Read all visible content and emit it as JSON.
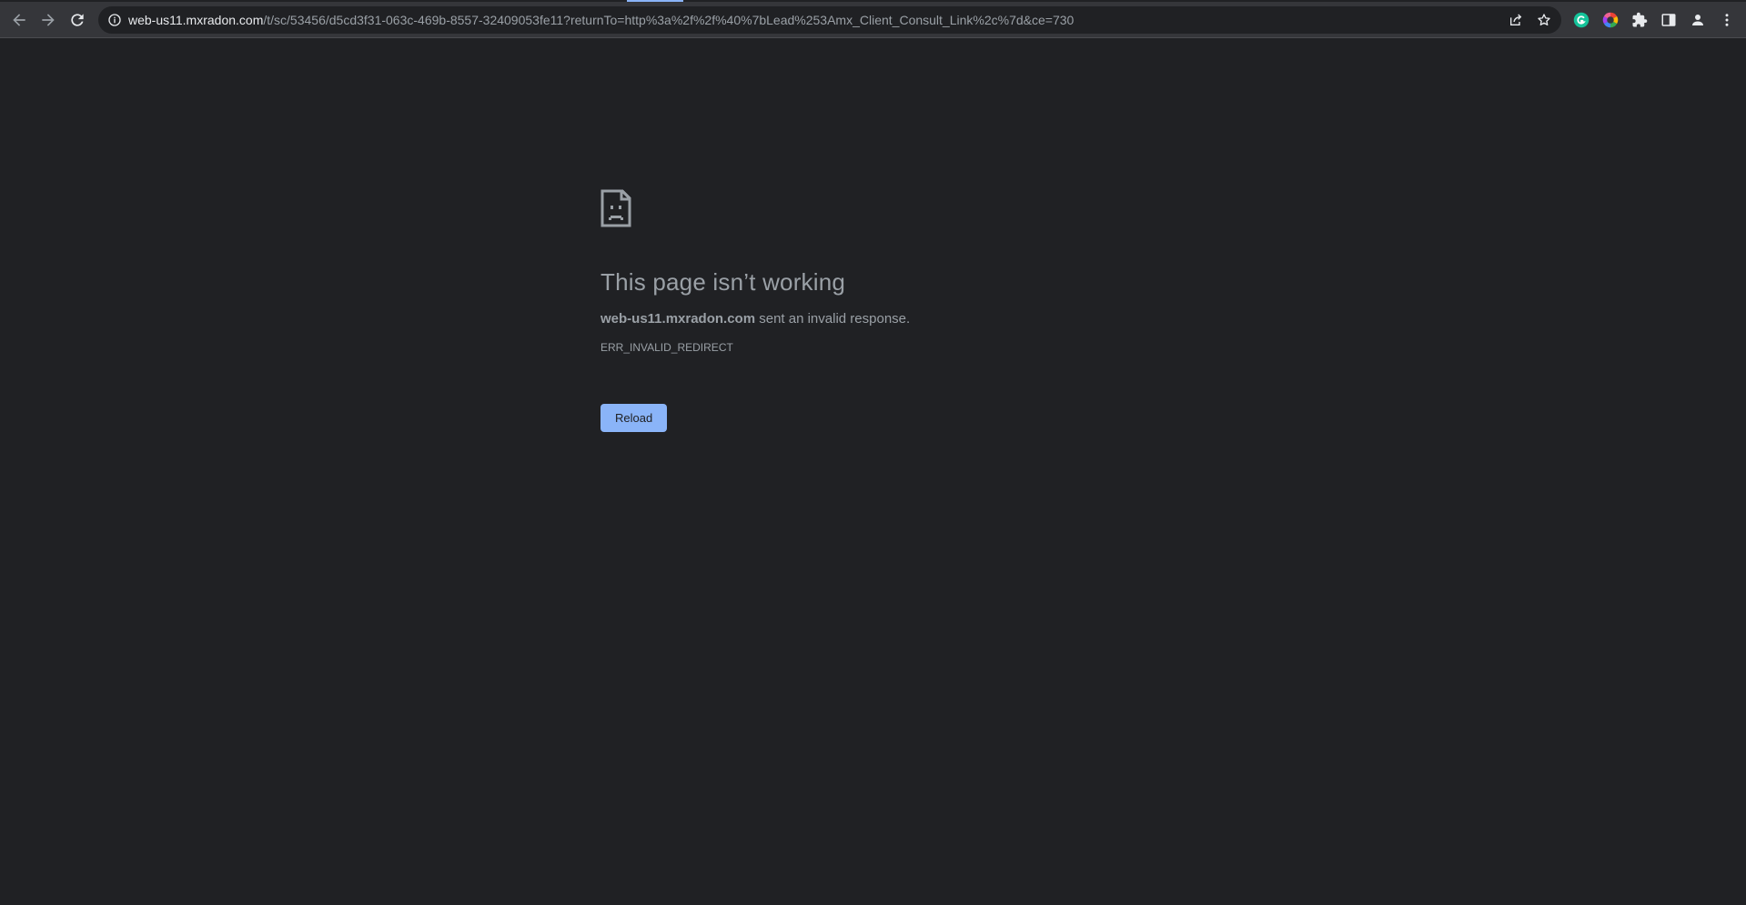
{
  "browser": {
    "url_host": "web-us11.mxradon.com",
    "url_path": "/t/sc/53456/d5cd3f31-063c-469b-8557-32409053fe11?returnTo=http%3a%2f%2f%40%7bLead%253Amx_Client_Consult_Link%2c%7d&ce=730",
    "icons": {
      "back": "back-arrow-icon",
      "forward": "forward-arrow-icon",
      "reload": "reload-icon",
      "site_info": "info-icon",
      "share": "share-icon",
      "bookmark": "star-icon",
      "grammarly": "grammarly-icon",
      "color_ext": "color-wheel-icon",
      "extensions": "puzzle-icon",
      "side_panel": "side-panel-icon",
      "profile": "profile-icon",
      "menu": "kebab-menu-icon"
    },
    "colors": {
      "toolbar": "#35363a",
      "omnibox": "#202124",
      "page_bg": "#202124",
      "accent": "#8ab4f8",
      "grammarly": "#15c39a"
    }
  },
  "error_page": {
    "icon": "sad-page-icon",
    "title": "This page isn’t working",
    "host": "web-us11.mxradon.com",
    "summary_suffix": " sent an invalid response.",
    "error_code": "ERR_INVALID_REDIRECT",
    "reload_label": "Reload"
  }
}
